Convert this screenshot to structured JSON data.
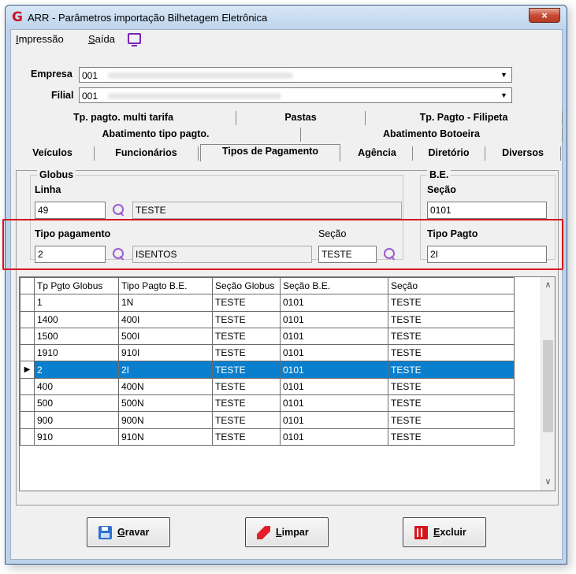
{
  "window": {
    "title": "ARR - Parâmetros importação Bilhetagem Eletrônica",
    "close_label": "×"
  },
  "menu": {
    "items": [
      {
        "accel": "I",
        "rest": "mpressão"
      },
      {
        "accel": "S",
        "rest": "aída"
      }
    ]
  },
  "empresa": {
    "label": "Empresa",
    "value": "001"
  },
  "filial": {
    "label": "Filial",
    "value": "001"
  },
  "tabs": {
    "row1": [
      "Tp. pagto. multi tarifa",
      "Pastas",
      "Tp. Pagto - Filipeta"
    ],
    "row2": [
      "Abatimento tipo pagto.",
      "Abatimento Botoeira"
    ],
    "row3": [
      "Veículos",
      "Funcionários",
      "Tipos de Pagamento",
      "Agência",
      "Diretório",
      "Diversos"
    ],
    "active": "Tipos de Pagamento"
  },
  "globus": {
    "title": "Globus",
    "linha_label": "Linha",
    "linha_value": "49",
    "linha_desc": "TESTE",
    "tipo_label": "Tipo pagamento",
    "tipo_value": "2",
    "tipo_desc": "ISENTOS",
    "secao_label": "Seção",
    "secao_value": "TESTE"
  },
  "be": {
    "title": "B.E.",
    "secao_label": "Seção",
    "secao_value": "0101",
    "tipo_label": "Tipo Pagto",
    "tipo_value": "2I"
  },
  "grid": {
    "columns": [
      "Tp Pgto Globus",
      "Tipo Pagto B.E.",
      "Seção Globus",
      "Seção B.E.",
      "Seção"
    ],
    "rows": [
      [
        "1",
        "1N",
        "TESTE",
        "0101",
        "TESTE"
      ],
      [
        "1400",
        "400I",
        "TESTE",
        "0101",
        "TESTE"
      ],
      [
        "1500",
        "500I",
        "TESTE",
        "0101",
        "TESTE"
      ],
      [
        "1910",
        "910I",
        "TESTE",
        "0101",
        "TESTE"
      ],
      [
        "2",
        "2I",
        "TESTE",
        "0101",
        "TESTE"
      ],
      [
        "400",
        "400N",
        "TESTE",
        "0101",
        "TESTE"
      ],
      [
        "500",
        "500N",
        "TESTE",
        "0101",
        "TESTE"
      ],
      [
        "900",
        "900N",
        "TESTE",
        "0101",
        "TESTE"
      ],
      [
        "910",
        "910N",
        "TESTE",
        "0101",
        "TESTE"
      ]
    ],
    "selected_row": 4,
    "selected_color": "#0a7fcd"
  },
  "buttons": {
    "gravar": {
      "accel": "G",
      "rest": "ravar",
      "icon": "save-icon"
    },
    "limpar": {
      "accel": "L",
      "rest": "impar",
      "icon": "eraser-icon"
    },
    "excluir": {
      "accel": "E",
      "rest": "xcluir",
      "icon": "trash-icon"
    }
  }
}
